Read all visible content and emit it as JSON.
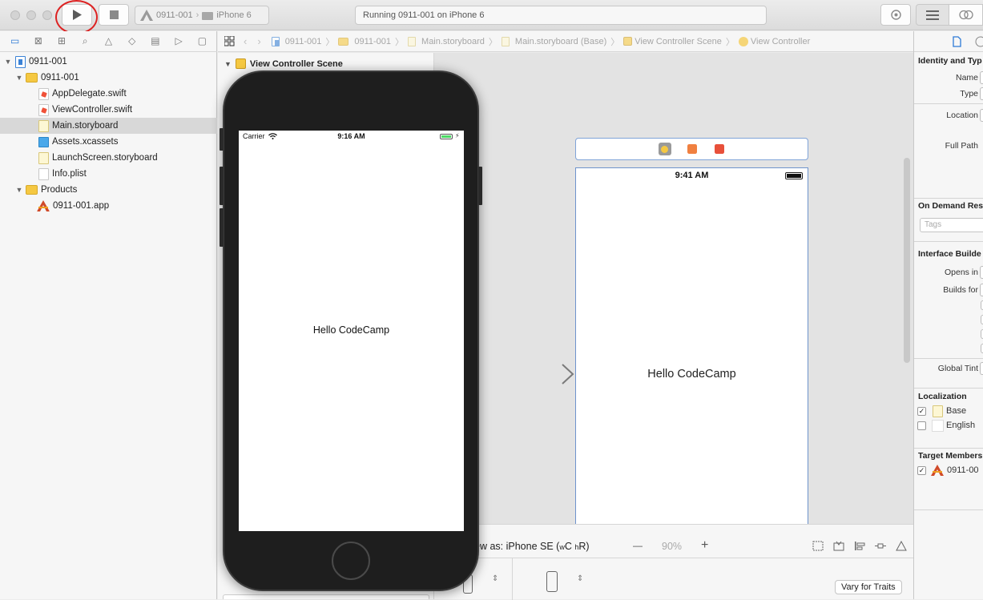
{
  "toolbar": {
    "scheme": "0911-001",
    "device": "iPhone 6",
    "status": "Running 0911-001 on iPhone 6"
  },
  "navigator": {
    "items": [
      {
        "label": "0911-001",
        "icon": "project-icon"
      },
      {
        "label": "0911-001",
        "icon": "folder-icon"
      },
      {
        "label": "AppDelegate.swift",
        "icon": "swift-file-icon"
      },
      {
        "label": "ViewController.swift",
        "icon": "swift-file-icon"
      },
      {
        "label": "Main.storyboard",
        "icon": "storyboard-file-icon"
      },
      {
        "label": "Assets.xcassets",
        "icon": "asset-catalog-icon"
      },
      {
        "label": "LaunchScreen.storyboard",
        "icon": "storyboard-file-icon"
      },
      {
        "label": "Info.plist",
        "icon": "plist-file-icon"
      },
      {
        "label": "Products",
        "icon": "folder-icon"
      },
      {
        "label": "0911-001.app",
        "icon": "app-icon"
      }
    ]
  },
  "jump_bar": {
    "crumbs": [
      "0911-001",
      "0911-001",
      "Main.storyboard",
      "Main.storyboard (Base)",
      "View Controller Scene",
      "View Controller"
    ]
  },
  "outline": {
    "scene_title": "View Controller Scene"
  },
  "simulator": {
    "carrier": "Carrier",
    "time": "9:16 AM",
    "label": "Hello CodeCamp"
  },
  "canvas": {
    "status_time": "9:41 AM",
    "label": "Hello CodeCamp",
    "view_as": "ew as: iPhone SE (",
    "view_as_w": "w",
    "view_as_c": "C",
    "view_as_h": "h",
    "view_as_r": "R)",
    "zoom": "90%",
    "zoom_out": "—",
    "zoom_in": "+",
    "vary_for_traits": "Vary for Traits"
  },
  "inspector": {
    "identity_head": "Identity and Typ",
    "name_label": "Name",
    "type_label": "Type",
    "location_label": "Location",
    "full_path_label": "Full Path",
    "on_demand_head": "On Demand Reso",
    "tags_placeholder": "Tags",
    "ib_head": "Interface Builde",
    "opens_in_label": "Opens in",
    "builds_for_label": "Builds for",
    "global_tint_label": "Global Tint",
    "localization_head": "Localization",
    "loc_base": "Base",
    "loc_english": "English",
    "target_head": "Target Members",
    "target_item": "0911-00"
  },
  "colors": {
    "run_highlight": "#dd2222",
    "selection_bg": "#d8d8d8",
    "canvas_bg": "#e3e3e3",
    "vc_border": "#6e93cc"
  }
}
